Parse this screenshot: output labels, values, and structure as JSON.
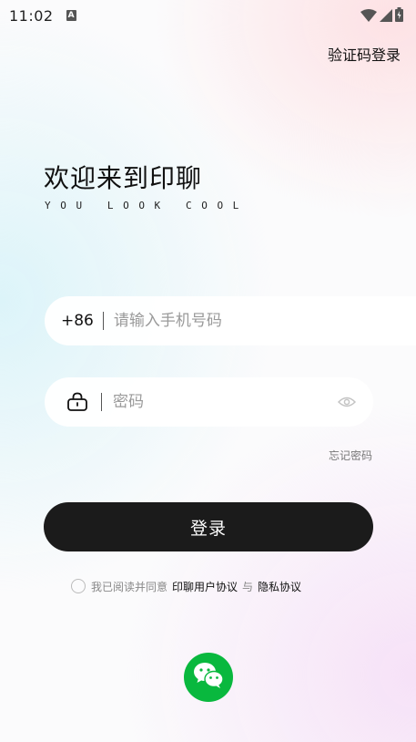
{
  "status_bar": {
    "time": "11:02",
    "notification_glyph": "A"
  },
  "header": {
    "switch_login_label": "验证码登录"
  },
  "welcome": {
    "title": "欢迎来到印聊",
    "subtitle": "YOU LOOK COOL"
  },
  "phone_field": {
    "country_code": "+86",
    "placeholder": "请输入手机号码",
    "value": ""
  },
  "password_field": {
    "placeholder": "密码",
    "value": "",
    "lock_icon": "lock-icon",
    "visibility_icon": "eye-icon"
  },
  "forgot_password_label": "忘记密码",
  "login_button_label": "登录",
  "agreement": {
    "checked": false,
    "prefix": "我已阅读并同意",
    "user_agreement": "印聊用户协议",
    "conjunction": "与",
    "privacy_policy": "隐私协议"
  },
  "wechat_login": {
    "icon": "wechat-icon",
    "color": "#09b83e"
  },
  "colors": {
    "primary_button": "#1b1b1b",
    "wechat": "#09b83e",
    "hint_text": "#9a9a9a"
  }
}
